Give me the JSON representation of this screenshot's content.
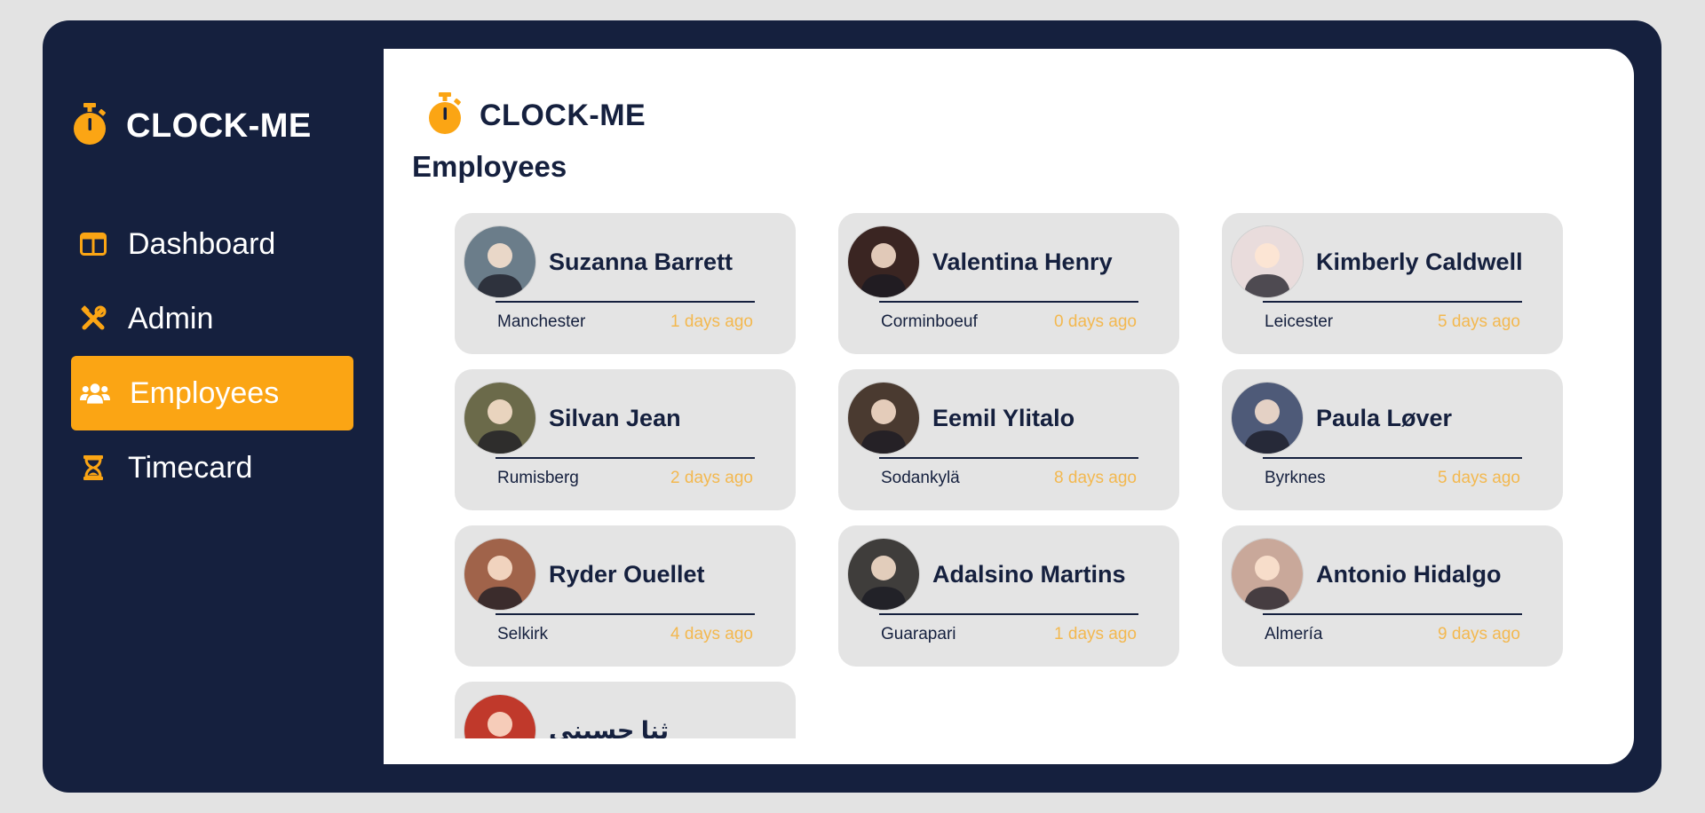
{
  "app": {
    "brand_name": "CLOCK-ME",
    "accent_color": "#fba514",
    "dark_color": "#15203e"
  },
  "sidebar": {
    "items": [
      {
        "label": "Dashboard",
        "icon": "dashboard-icon",
        "active": false
      },
      {
        "label": "Admin",
        "icon": "tools-icon",
        "active": false
      },
      {
        "label": "Employees",
        "icon": "users-icon",
        "active": true
      },
      {
        "label": "Timecard",
        "icon": "hourglass-icon",
        "active": false
      }
    ]
  },
  "main": {
    "brand_name": "CLOCK-ME",
    "title": "Employees",
    "employees": [
      {
        "name": "Suzanna Barrett",
        "city": "Manchester",
        "last_seen": "1 days ago",
        "avatar_color": "#6b7d8a"
      },
      {
        "name": "Valentina Henry",
        "city": "Corminboeuf",
        "last_seen": "0 days ago",
        "avatar_color": "#3a2522"
      },
      {
        "name": "Kimberly Caldwell",
        "city": "Leicester",
        "last_seen": "5 days ago",
        "avatar_color": "#e9dcdc"
      },
      {
        "name": "Silvan Jean",
        "city": "Rumisberg",
        "last_seen": "2 days ago",
        "avatar_color": "#6b6a4a"
      },
      {
        "name": "Eemil Ylitalo",
        "city": "Sodankylä",
        "last_seen": "8 days ago",
        "avatar_color": "#4a3a30"
      },
      {
        "name": "Paula Løver",
        "city": "Byrknes",
        "last_seen": "5 days ago",
        "avatar_color": "#4e5a78"
      },
      {
        "name": "Ryder Ouellet",
        "city": "Selkirk",
        "last_seen": "4 days ago",
        "avatar_color": "#a0634a"
      },
      {
        "name": "Adalsino Martins",
        "city": "Guarapari",
        "last_seen": "1 days ago",
        "avatar_color": "#3f3d3b"
      },
      {
        "name": "Antonio Hidalgo",
        "city": "Almería",
        "last_seen": "9 days ago",
        "avatar_color": "#c9a89a"
      },
      {
        "name": "ثنا حسيني",
        "city": "",
        "last_seen": "",
        "avatar_color": "#c0392b"
      }
    ]
  }
}
